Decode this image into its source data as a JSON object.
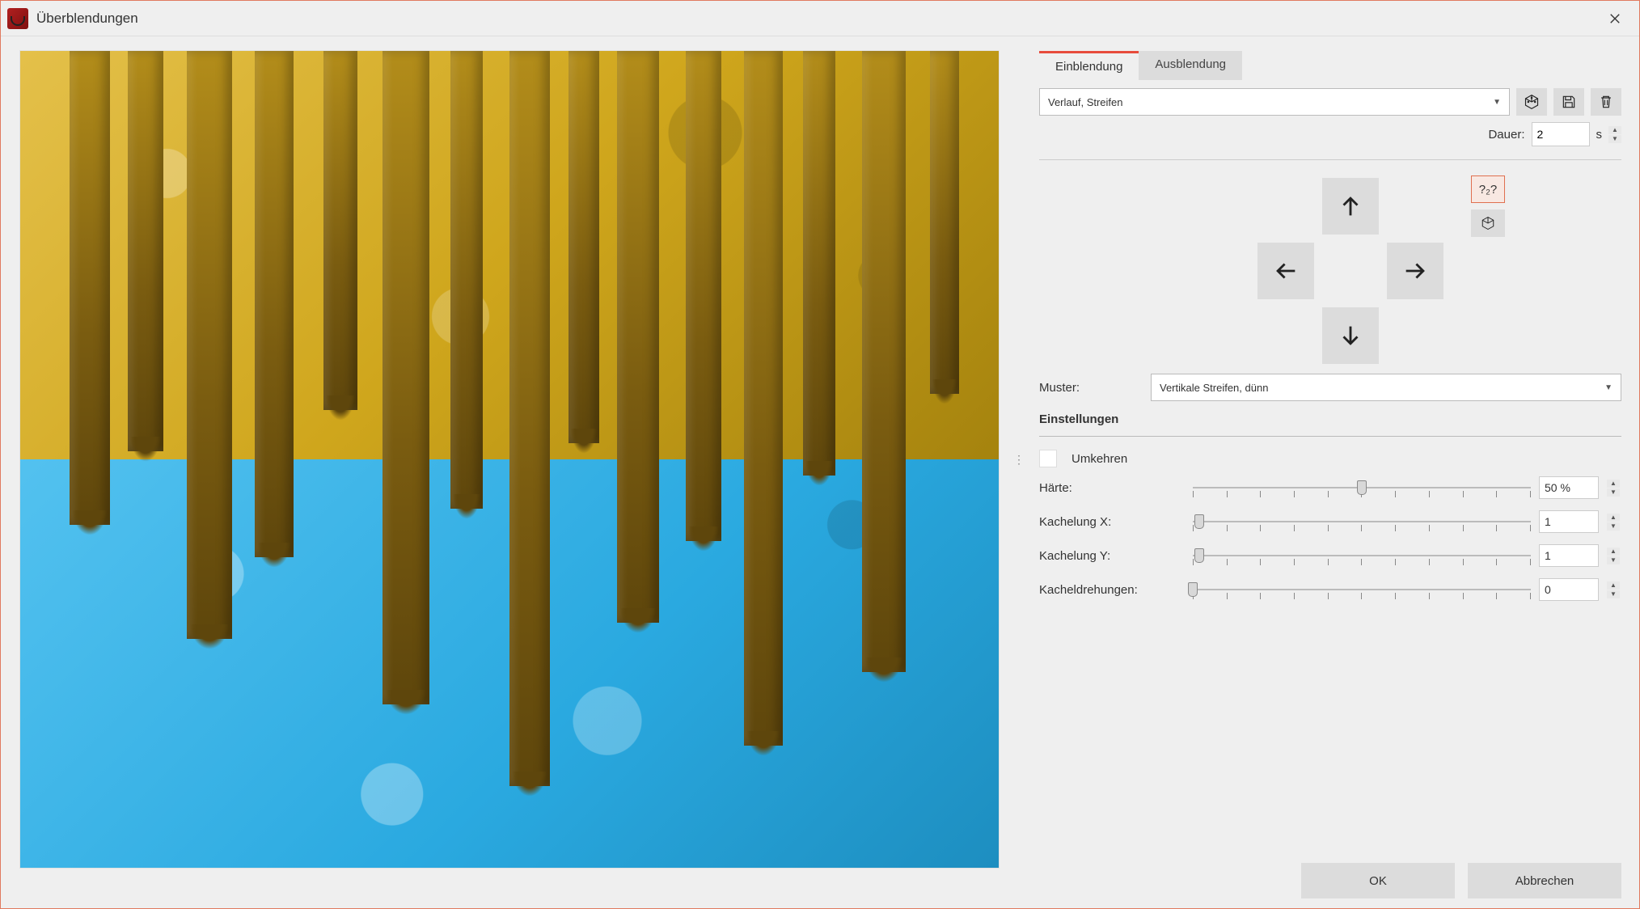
{
  "window": {
    "title": "Überblendungen"
  },
  "tabs": {
    "fade_in": "Einblendung",
    "fade_out": "Ausblendung"
  },
  "transition_select": "Verlauf, Streifen",
  "duration": {
    "label": "Dauer:",
    "value": "2",
    "unit": "s"
  },
  "pattern": {
    "label": "Muster:",
    "value": "Vertikale Streifen, dünn"
  },
  "random_mode": {
    "label": "?₂?"
  },
  "settings": {
    "heading": "Einstellungen",
    "invert": "Umkehren",
    "hardness": {
      "label": "Härte:",
      "value": "50 %",
      "percent": 50
    },
    "tile_x": {
      "label": "Kachelung X:",
      "value": "1",
      "percent": 2
    },
    "tile_y": {
      "label": "Kachelung Y:",
      "value": "1",
      "percent": 2
    },
    "tile_rot": {
      "label": "Kacheldrehungen:",
      "value": "0",
      "percent": 0
    }
  },
  "buttons": {
    "ok": "OK",
    "cancel": "Abbrechen"
  }
}
